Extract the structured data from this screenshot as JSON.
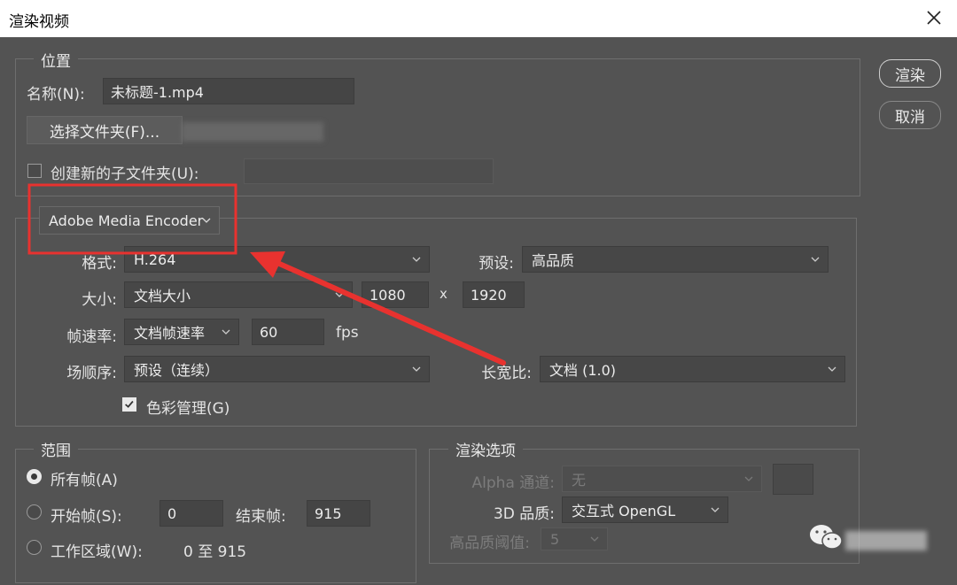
{
  "window": {
    "title": "渲染视频"
  },
  "buttons": {
    "render": "渲染",
    "cancel": "取消"
  },
  "location": {
    "group_label": "位置",
    "name_label": "名称(N):",
    "name_value": "未标题-1.mp4",
    "choose_folder": "选择文件夹(F)...",
    "create_subfolder_label": "创建新的子文件夹(U):",
    "create_subfolder_checked": false
  },
  "encoder": {
    "selected": "Adobe Media Encoder",
    "format_label": "格式:",
    "format_value": "H.264",
    "preset_label": "预设:",
    "preset_value": "高品质",
    "size_label": "大小:",
    "size_value": "文档大小",
    "width": "1080",
    "times": "x",
    "height": "1920",
    "framerate_label": "帧速率:",
    "framerate_value": "文档帧速率",
    "fps_value": "60",
    "fps_unit": "fps",
    "field_order_label": "场顺序:",
    "field_order_value": "预设（连续）",
    "aspect_label": "长宽比:",
    "aspect_value": "文档 (1.0)",
    "color_mgmt_label": "色彩管理(G)",
    "color_mgmt_checked": true
  },
  "range": {
    "group_label": "范围",
    "all_frames": "所有帧(A)",
    "start_frame_label": "开始帧(S):",
    "start_frame_value": "0",
    "end_frame_label": "结束帧:",
    "end_frame_value": "915",
    "work_area_label": "工作区域(W):",
    "work_area_value": "0 至 915",
    "selected": "all_frames"
  },
  "render_options": {
    "group_label": "渲染选项",
    "alpha_label": "Alpha 通道:",
    "alpha_value": "无",
    "quality_3d_label": "3D 品质:",
    "quality_3d_value": "交互式 OpenGL",
    "threshold_label": "高品质阈值:",
    "threshold_value": "5"
  },
  "colors": {
    "background": "#535353",
    "annotation": "#e8322f"
  }
}
